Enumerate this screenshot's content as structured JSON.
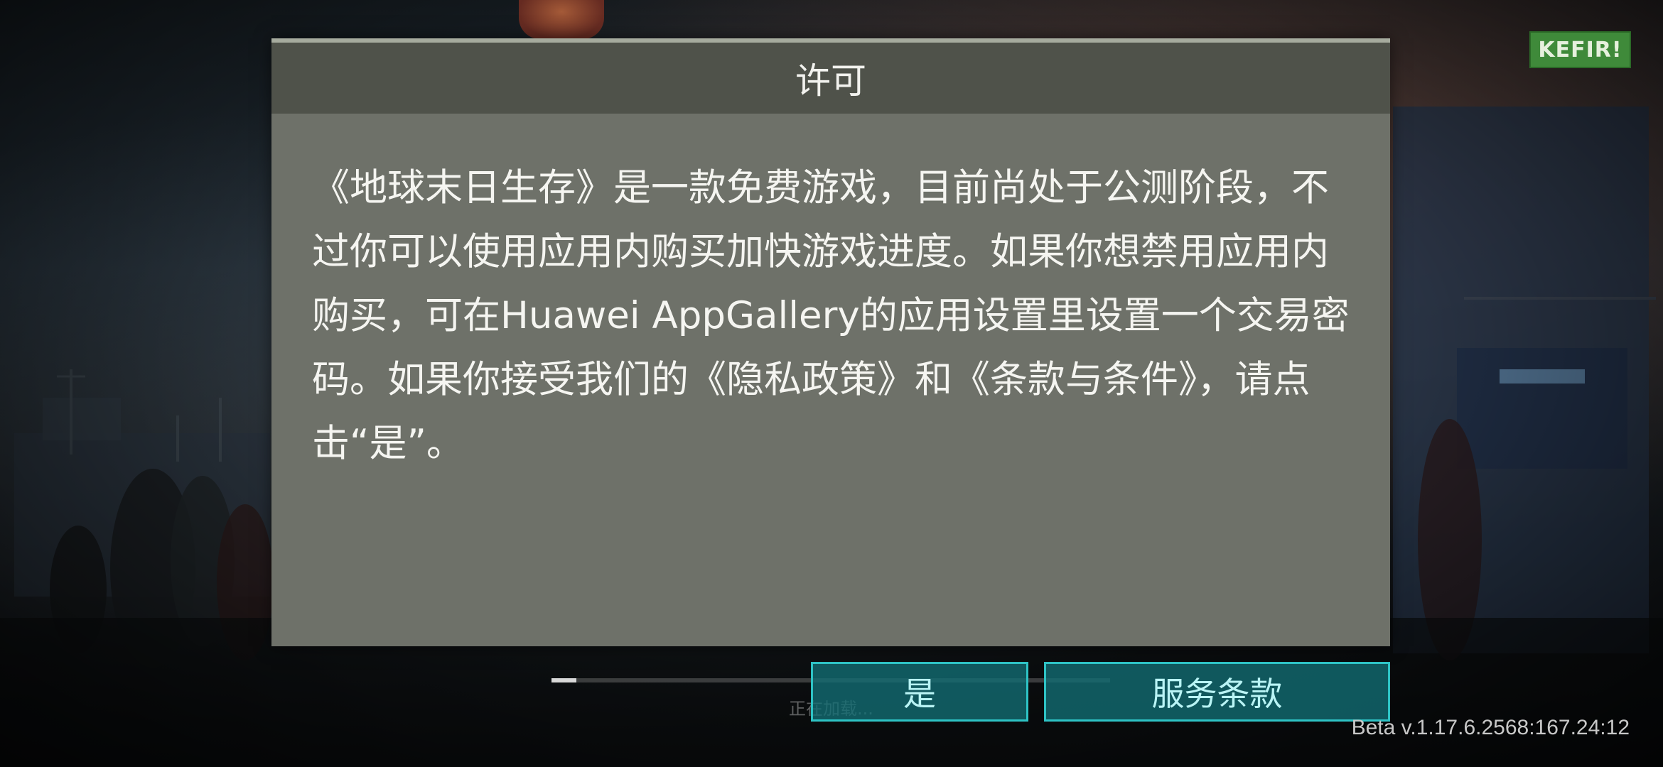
{
  "background": {
    "logo_text": "KEFIR!",
    "accent_colors": {
      "logo_green": "#3f8a3a",
      "button_cyan": "#2ec3c5",
      "dialog_gray": "#6e7169"
    }
  },
  "dialog": {
    "title": "许可",
    "body": "《地球末日生存》是一款免费游戏，目前尚处于公测阶段，不过你可以使用应用内购买加快游戏进度。如果你想禁用应用内购买，可在Huawei AppGallery的应用设置里设置一个交易密码。如果你接受我们的《隐私政策》和《条款与条件》，请点击“是”。"
  },
  "loading": {
    "label": "正在加载...",
    "progress_fraction": 0.045
  },
  "buttons": {
    "yes": "是",
    "terms": "服务条款"
  },
  "version": "Beta v.1.17.6.2568:167.24:12"
}
